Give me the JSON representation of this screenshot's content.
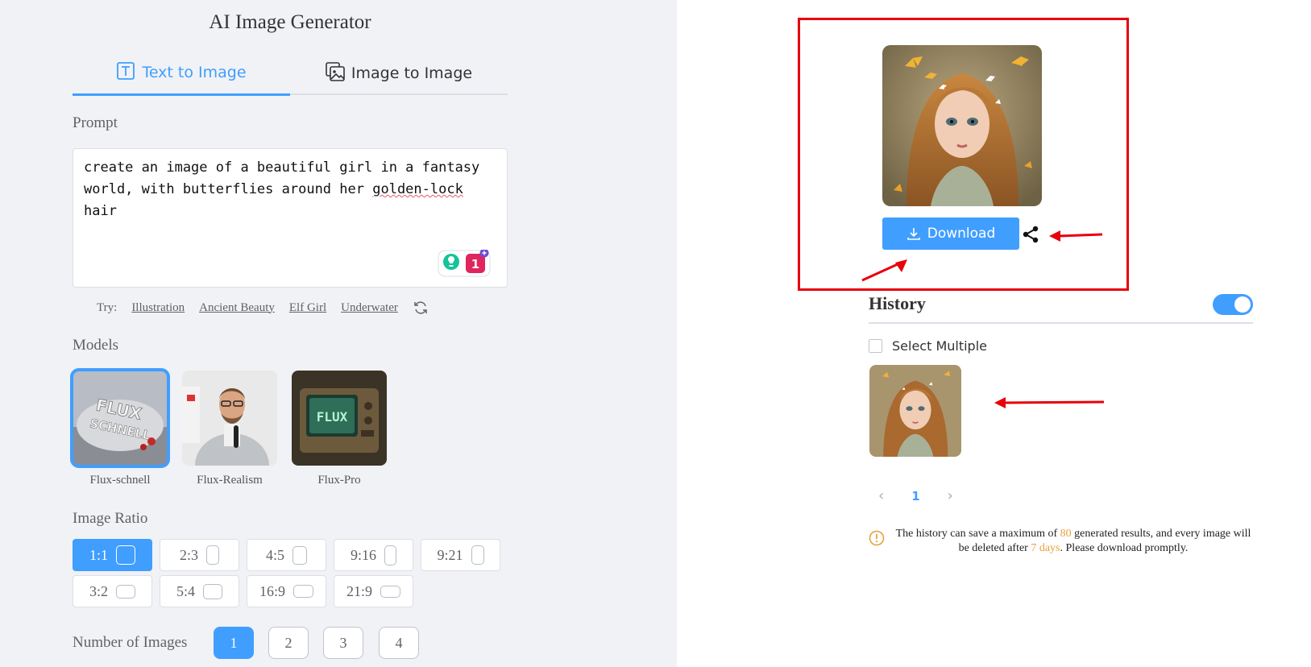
{
  "app": {
    "title": "AI Image Generator"
  },
  "tabs": [
    {
      "label": "Text to Image",
      "icon": "text-icon",
      "active": true
    },
    {
      "label": "Image to Image",
      "icon": "image-icon",
      "active": false
    }
  ],
  "prompt": {
    "label": "Prompt",
    "value_line1": "create an image of a beautiful girl in a fantasy",
    "value_line2_before": "world, with butterflies around her ",
    "value_line2_misspelled": "golden-lock",
    "value_line2_after": " hair",
    "grammarly_count": "1"
  },
  "try": {
    "label": "Try:",
    "suggestions": [
      "Illustration",
      "Ancient Beauty",
      "Elf Girl",
      "Underwater"
    ],
    "icon": "refresh-icon"
  },
  "models": {
    "label": "Models",
    "items": [
      {
        "name": "Flux-schnell",
        "selected": true,
        "thumb_text": "FLUX SCHNELL"
      },
      {
        "name": "Flux-Realism",
        "selected": false
      },
      {
        "name": "Flux-Pro",
        "selected": false,
        "thumb_text": "FLUX"
      }
    ]
  },
  "ratio": {
    "label": "Image Ratio",
    "options": [
      "1:1",
      "2:3",
      "4:5",
      "9:16",
      "9:21",
      "3:2",
      "5:4",
      "16:9",
      "21:9"
    ],
    "selected": "1:1"
  },
  "count": {
    "label": "Number of Images",
    "options": [
      "1",
      "2",
      "3",
      "4"
    ],
    "selected": "1"
  },
  "result": {
    "download_label": "Download",
    "download_icon": "download-icon",
    "share_icon": "share-icon"
  },
  "history": {
    "title": "History",
    "toggle_on": true,
    "select_multiple_label": "Select Multiple",
    "page": "1",
    "notice_part1": "The history can save a maximum of ",
    "notice_max": "80",
    "notice_part2": " generated results, and every image will be deleted after ",
    "notice_days": "7 days",
    "notice_part3": ". Please download promptly."
  },
  "colors": {
    "accent": "#409eff",
    "annotation_red": "#e8000b",
    "warning": "#e6a23c",
    "panel_bg": "#f0f2f5"
  }
}
